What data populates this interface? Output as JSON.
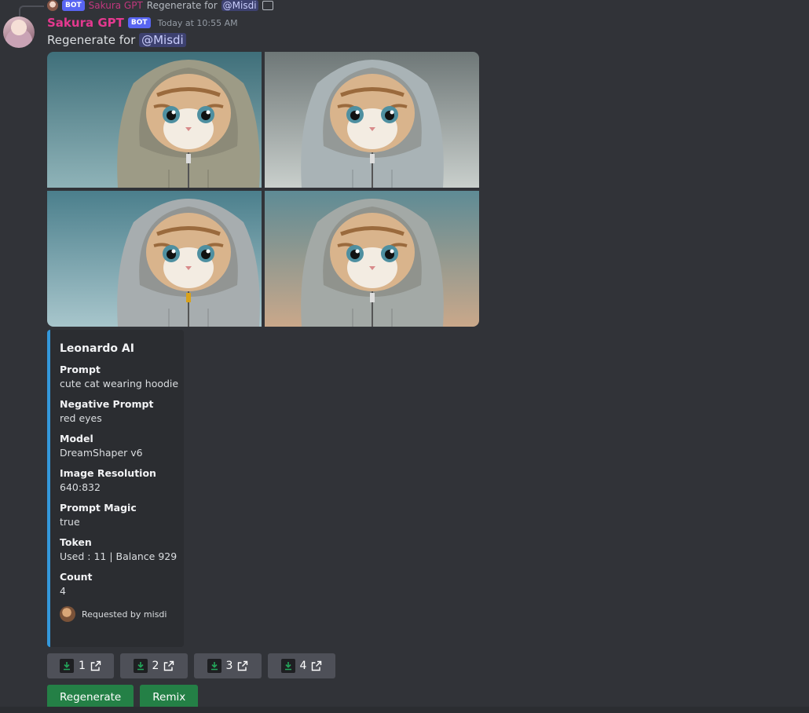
{
  "reply": {
    "bot_tag": "BOT",
    "name": "Sakura GPT",
    "text": "Regenerate for",
    "mention": "@Misdi"
  },
  "message": {
    "username": "Sakura GPT",
    "bot_tag": "BOT",
    "timestamp": "Today at 10:55 AM",
    "text_prefix": "Regenerate for ",
    "mention": "@Misdi"
  },
  "images": [
    {
      "label": "cat-hoodie-1",
      "hoodie_color": "#9d9b86"
    },
    {
      "label": "cat-hoodie-2",
      "hoodie_color": "#a9b3b6"
    },
    {
      "label": "cat-hoodie-3",
      "hoodie_color": "#a7adaf"
    },
    {
      "label": "cat-hoodie-4",
      "hoodie_color": "#a3a9a6"
    }
  ],
  "embed": {
    "accent_color": "#3498db",
    "title": "Leonardo AI",
    "fields": [
      {
        "name": "Prompt",
        "value": "cute cat wearing hoodie"
      },
      {
        "name": "Negative Prompt",
        "value": "red eyes"
      },
      {
        "name": "Model",
        "value": "DreamShaper v6"
      },
      {
        "name": "Image Resolution",
        "value": "640:832"
      },
      {
        "name": "Prompt Magic",
        "value": "true"
      },
      {
        "name": "Token",
        "value": "Used : 11 | Balance 929"
      },
      {
        "name": "Count",
        "value": "4"
      }
    ],
    "footer": "Requested by misdi"
  },
  "download_buttons": [
    "1",
    "2",
    "3",
    "4"
  ],
  "actions": {
    "regenerate": "Regenerate",
    "remix": "Remix"
  },
  "colors": {
    "background": "#313338",
    "username": "#e4398f",
    "bot_tag": "#5865f2",
    "button_gray": "#4e5058",
    "button_green": "#248046"
  }
}
